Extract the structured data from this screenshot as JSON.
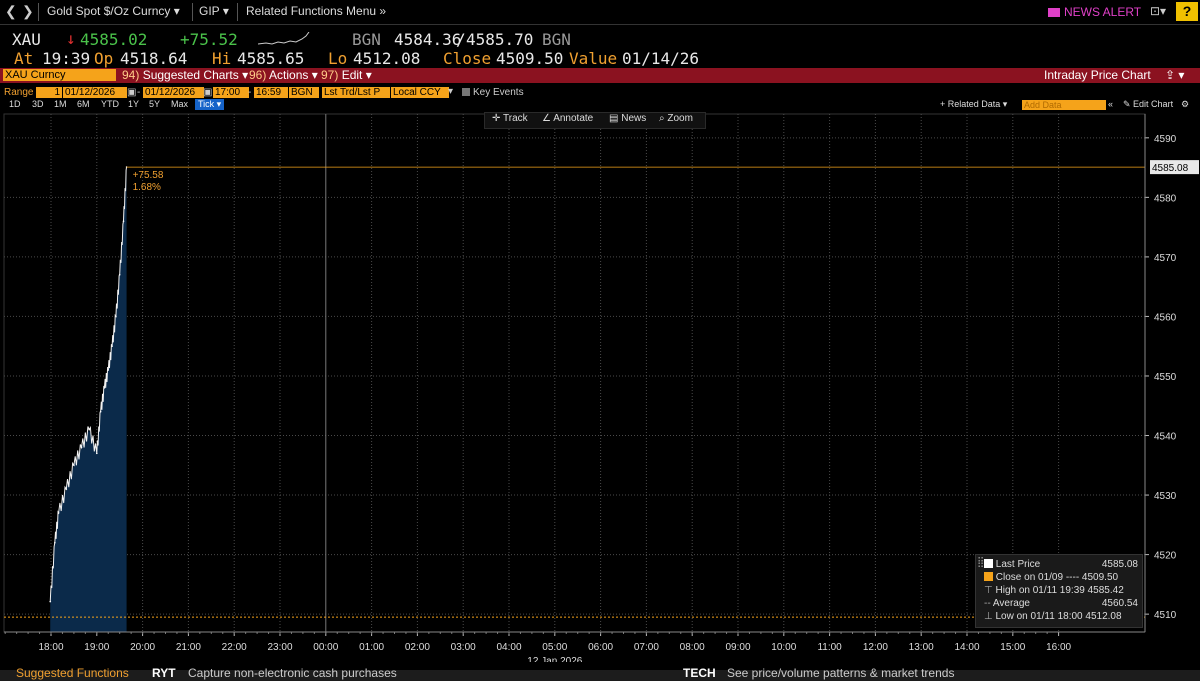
{
  "nav": {
    "security_desc": "Gold Spot $/Oz Curncy",
    "currency": "GIP",
    "related_menu": "Related Functions Menu",
    "news_alert": "NEWS ALERT",
    "help": "?"
  },
  "quote": {
    "ticker": "XAU",
    "last": "4585.02",
    "change": "+75.52",
    "bgn_label": "BGN",
    "bid_ask": "4584.36",
    "ask": "4585.70",
    "bgn_label2": "BGN",
    "at_label": "At",
    "at_time": "19:39",
    "op_label": "Op",
    "op": "4518.64",
    "hi_label": "Hi",
    "hi": "4585.65",
    "lo_label": "Lo",
    "lo": "4512.08",
    "close_label": "Close",
    "close": "4509.50",
    "value_label": "Value",
    "value_date": "01/14/26"
  },
  "cmdbar": {
    "security": "XAU Curncy",
    "suggested_num": "94)",
    "suggested": "Suggested Charts",
    "actions_num": "96)",
    "actions": "Actions",
    "edit_num": "97)",
    "edit": "Edit",
    "title": "Intraday Price Chart"
  },
  "range": {
    "label": "Range",
    "n": "1",
    "start": "01/12/2026",
    "end": "01/12/2026",
    "t1": "17:00",
    "t2": "16:59",
    "source": "BGN",
    "field": "Lst Trd/Lst P",
    "ccy": "Local CCY",
    "key_events": "Key Events"
  },
  "periods": {
    "items": [
      "1D",
      "3D",
      "1M",
      "6M",
      "YTD",
      "1Y",
      "5Y",
      "Max"
    ],
    "active": "Tick",
    "related_data": "+ Related Data",
    "add_data": "Add Data",
    "edit_chart": "Edit Chart"
  },
  "tools": {
    "track": "Track",
    "annotate": "Annotate",
    "news": "News",
    "zoom": "Zoom"
  },
  "chart_data": {
    "type": "area",
    "y_ticks": [
      4510,
      4520,
      4530,
      4540,
      4550,
      4560,
      4570,
      4580,
      4590
    ],
    "ylim": [
      4507,
      4594
    ],
    "x_ticks": [
      "18:00",
      "19:00",
      "20:00",
      "21:00",
      "22:00",
      "23:00",
      "00:00",
      "01:00",
      "02:00",
      "03:00",
      "04:00",
      "05:00",
      "06:00",
      "07:00",
      "08:00",
      "09:00",
      "10:00",
      "11:00",
      "12:00",
      "13:00",
      "14:00",
      "15:00",
      "16:00"
    ],
    "date_label": "12 Jan 2026",
    "last_price_tag": "4585.08",
    "change_annotation": "+75.58",
    "change_pct_annotation": "1.68%",
    "close_level": 4509.5,
    "series_x": [
      "17:59",
      "18:05",
      "18:10",
      "18:20",
      "18:30",
      "18:40",
      "18:50",
      "19:00",
      "19:05",
      "19:10",
      "19:15",
      "19:20",
      "19:25",
      "19:30",
      "19:35",
      "19:39"
    ],
    "series_y": [
      4512.1,
      4522,
      4527,
      4531,
      4535,
      4538,
      4541,
      4537,
      4544,
      4548,
      4551,
      4555,
      4560,
      4567,
      4576,
      4585.1
    ]
  },
  "legend": {
    "items": [
      {
        "label": "Last Price",
        "value": "4585.08"
      },
      {
        "label": "Close on 01/09 ---- 4509.50",
        "value": ""
      },
      {
        "label": "High on 01/11 19:39 4585.42",
        "value": ""
      },
      {
        "label": "Average",
        "value": "4560.54"
      },
      {
        "label": "Low on 01/11 18:00 4512.08",
        "value": ""
      }
    ]
  },
  "bottom": {
    "left": "Suggested Functions",
    "mid_code": "RYT",
    "mid_text": "Capture non-electronic cash purchases",
    "right_code": "TECH",
    "right_text": "See price/volume patterns & market trends"
  },
  "colors": {
    "amber": "#f5a31a",
    "red_bar": "#8b1220",
    "area_fill": "#0b2a4a",
    "news": "#e040c8"
  }
}
